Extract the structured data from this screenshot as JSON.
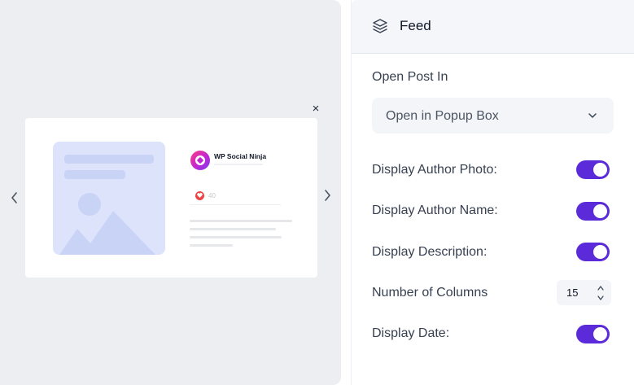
{
  "preview": {
    "close_glyph": "×",
    "author_name": "WP Social Ninja",
    "likes_count": "40"
  },
  "settings": {
    "header_title": "Feed",
    "header_icon": "layers-icon",
    "open_post": {
      "label": "Open Post In",
      "value": "Open in Popup Box"
    },
    "display_author_photo": {
      "label": "Display Author Photo:",
      "enabled": true
    },
    "display_author_name": {
      "label": "Display Author Name:",
      "enabled": true
    },
    "display_description": {
      "label": "Display Description:",
      "enabled": true
    },
    "number_of_columns": {
      "label": "Number of Columns",
      "value": "15"
    },
    "display_date": {
      "label": "Display Date:",
      "enabled": true
    }
  },
  "colors": {
    "toggle_on": "#5b2bd9",
    "preview_bg": "#eceef1",
    "image_placeholder": "#dce3fb",
    "like_heart": "#ef4444"
  }
}
